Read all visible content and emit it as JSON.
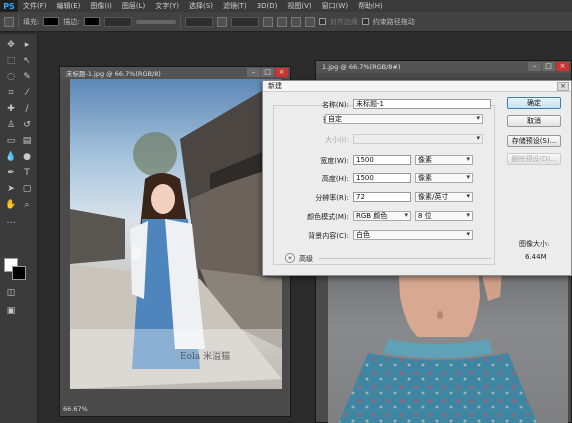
{
  "app": {
    "logo": "PS",
    "menu": [
      "文件(F)",
      "编辑(E)",
      "图像(I)",
      "图层(L)",
      "文字(Y)",
      "选择(S)",
      "滤镜(T)",
      "3D(D)",
      "视图(V)",
      "窗口(W)",
      "帮助(H)"
    ]
  },
  "options_bar": {
    "fill_label": "填充:",
    "stroke_label": "描边:",
    "align_edges_label": "对齐边缘",
    "constrain_path_label": "约束路径拖动"
  },
  "doc1": {
    "title": "未标题-1.jpg @ 66.7%(RGB/8)",
    "status": "66.67%",
    "watermark": "Eola 米溢猫"
  },
  "doc2": {
    "title": "1.jpg @ 66.7%(RGB/8#)"
  },
  "dialog": {
    "title": "新建",
    "close": "×",
    "name_label": "名称(N):",
    "name_value": "未标题-1",
    "preset_label": "预设(P):",
    "preset_value": "自定",
    "size_label": "大小(I):",
    "size_value": "",
    "width_label": "宽度(W):",
    "width_value": "1500",
    "width_unit": "像素",
    "height_label": "高度(H):",
    "height_value": "1500",
    "height_unit": "像素",
    "resolution_label": "分辨率(R):",
    "resolution_value": "72",
    "resolution_unit": "像素/英寸",
    "color_mode_label": "颜色模式(M):",
    "color_mode_value": "RGB 颜色",
    "bit_depth_value": "8 位",
    "bg_label": "背景内容(C):",
    "bg_value": "白色",
    "advanced_label": "高级",
    "advanced_symbol": "«",
    "ok": "确定",
    "cancel": "取消",
    "save_preset": "存储预设(S)...",
    "delete_preset": "删除预设(D)...",
    "image_size_label": "图像大小:",
    "image_size_value": "6.44M"
  }
}
